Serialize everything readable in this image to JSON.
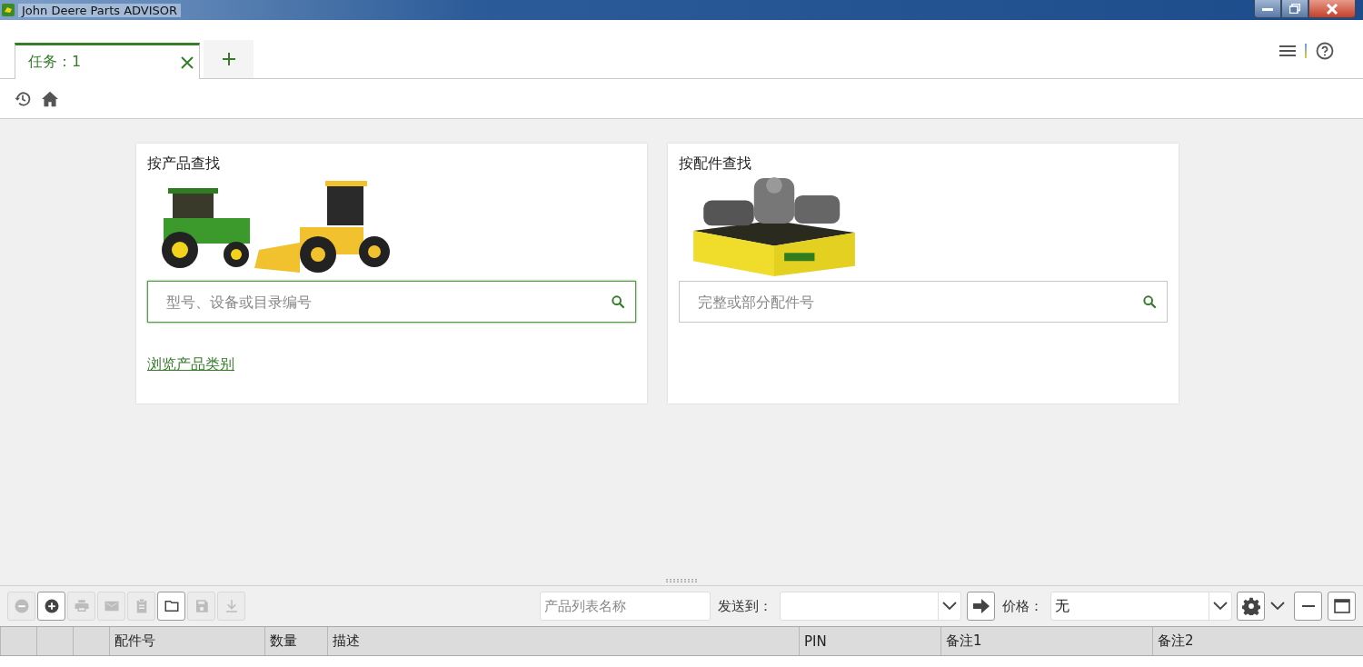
{
  "window": {
    "title": "John Deere Parts ADVISOR"
  },
  "tabs": [
    {
      "label": "任务：1",
      "selected": true
    }
  ],
  "cards": [
    {
      "title": "按产品查找",
      "search": {
        "placeholder": "型号、设备或目录编号",
        "focused": true
      },
      "link": "浏览产品类别"
    },
    {
      "title": "按配件查找",
      "search": {
        "placeholder": "完整或部分配件号",
        "focused": false
      }
    }
  ],
  "toolbar": {
    "buttons": [
      {
        "kind": "remove",
        "disabled": true
      },
      {
        "kind": "add",
        "disabled": false
      },
      {
        "kind": "print",
        "disabled": true
      },
      {
        "kind": "mail",
        "disabled": true
      },
      {
        "kind": "clipboard",
        "disabled": true
      },
      {
        "kind": "folder",
        "disabled": false
      },
      {
        "kind": "save",
        "disabled": true
      },
      {
        "kind": "download",
        "disabled": true
      }
    ],
    "list_name": {
      "placeholder": "产品列表名称"
    },
    "send_to": {
      "label": "发送到："
    },
    "price": {
      "label": "价格：",
      "value": "无"
    }
  },
  "table": {
    "columns": [
      "",
      "",
      "",
      "配件号",
      "数量",
      "描述",
      "PIN",
      "备注1",
      "备注2"
    ]
  }
}
